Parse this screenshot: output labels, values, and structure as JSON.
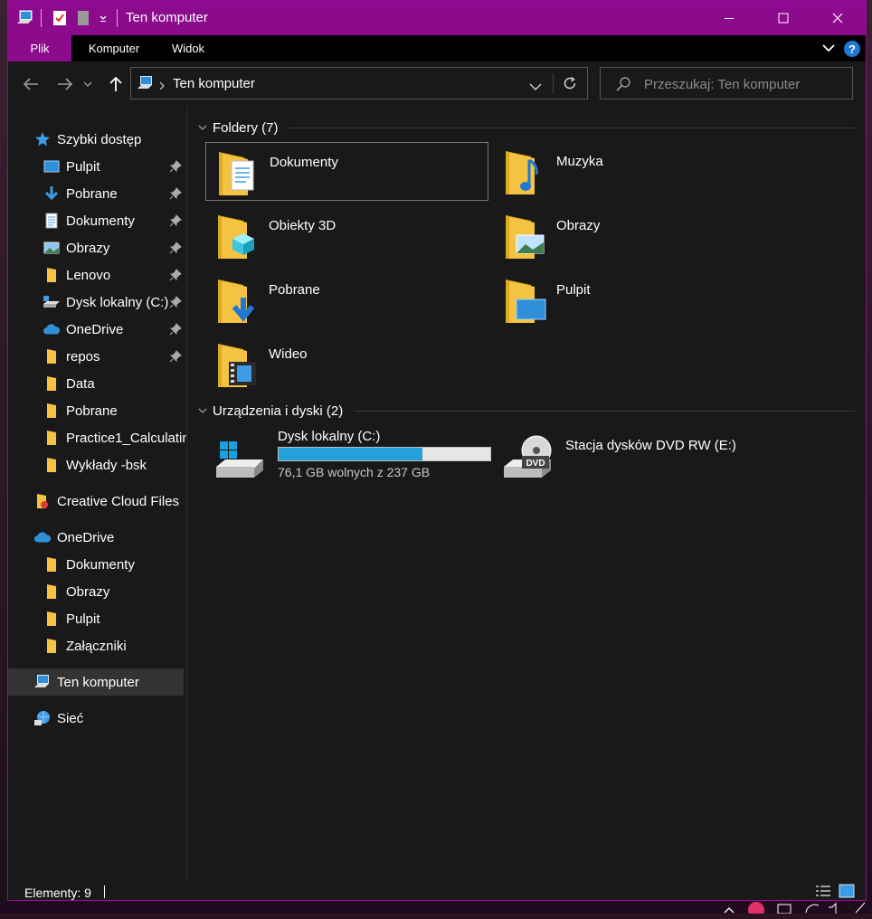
{
  "window": {
    "title": "Ten komputer",
    "accent_color": "#8c0a8c"
  },
  "ribbon": {
    "tabs": [
      {
        "label": "Plik",
        "active": true
      },
      {
        "label": "Komputer",
        "active": false
      },
      {
        "label": "Widok",
        "active": false
      }
    ]
  },
  "address_bar": {
    "path": "Ten komputer"
  },
  "search": {
    "placeholder": "Przeszukaj: Ten komputer"
  },
  "sidebar": {
    "quick_access": {
      "label": "Szybki dostęp",
      "items": [
        {
          "label": "Pulpit",
          "icon": "desktop-icon",
          "pinned": true
        },
        {
          "label": "Pobrane",
          "icon": "download-icon",
          "pinned": true
        },
        {
          "label": "Dokumenty",
          "icon": "document-icon",
          "pinned": true
        },
        {
          "label": "Obrazy",
          "icon": "pictures-icon",
          "pinned": true
        },
        {
          "label": "Lenovo",
          "icon": "folder-icon",
          "pinned": true
        },
        {
          "label": "Dysk lokalny (C:)",
          "icon": "drive-icon",
          "pinned": true
        },
        {
          "label": "OneDrive",
          "icon": "cloud-icon",
          "pinned": true
        },
        {
          "label": "repos",
          "icon": "folder-icon",
          "pinned": true
        },
        {
          "label": "Data",
          "icon": "folder-icon",
          "pinned": false
        },
        {
          "label": "Pobrane",
          "icon": "folder-icon",
          "pinned": false
        },
        {
          "label": "Practice1_Calculatin",
          "icon": "folder-icon",
          "pinned": false
        },
        {
          "label": "Wykłady -bsk",
          "icon": "folder-icon",
          "pinned": false
        }
      ]
    },
    "creative_cloud": {
      "label": "Creative Cloud Files"
    },
    "onedrive": {
      "label": "OneDrive",
      "items": [
        {
          "label": "Dokumenty"
        },
        {
          "label": "Obrazy"
        },
        {
          "label": "Pulpit"
        },
        {
          "label": "Załączniki"
        }
      ]
    },
    "this_pc": {
      "label": "Ten komputer"
    },
    "network": {
      "label": "Sieć"
    }
  },
  "content": {
    "folders_header": "Foldery (7)",
    "folders": [
      {
        "label": "Dokumenty",
        "icon": "documents-folder-icon"
      },
      {
        "label": "Muzyka",
        "icon": "music-folder-icon"
      },
      {
        "label": "Obiekty 3D",
        "icon": "3d-objects-folder-icon"
      },
      {
        "label": "Obrazy",
        "icon": "pictures-folder-icon"
      },
      {
        "label": "Pobrane",
        "icon": "downloads-folder-icon"
      },
      {
        "label": "Pulpit",
        "icon": "desktop-folder-icon"
      },
      {
        "label": "Wideo",
        "icon": "videos-folder-icon"
      }
    ],
    "devices_header": "Urządzenia i dyski (2)",
    "drives": [
      {
        "label": "Dysk lokalny (C:)",
        "free_text": "76,1 GB wolnych z 237 GB",
        "used_fraction": 0.68,
        "has_bar": true,
        "icon": "windows-drive-icon"
      },
      {
        "label": "Stacja dysków DVD RW (E:)",
        "has_bar": false,
        "icon": "dvd-drive-icon"
      }
    ]
  },
  "status": {
    "text": "Elementy: 9"
  },
  "colors": {
    "drive_bar": "#26a0da",
    "folder_yellow": "#f5c342"
  }
}
